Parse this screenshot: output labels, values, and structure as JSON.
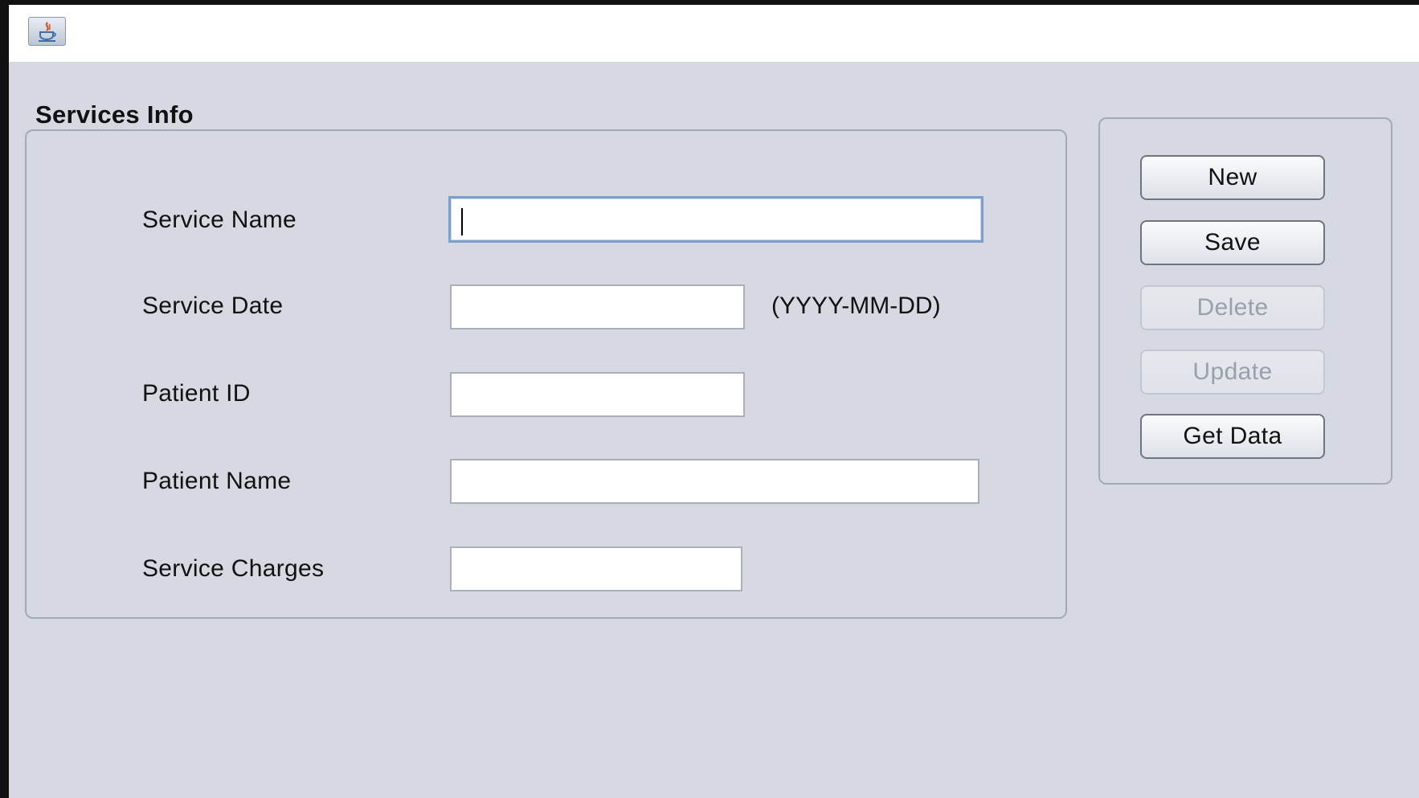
{
  "window": {
    "app_icon": "java-coffee-cup-icon"
  },
  "form": {
    "section_title": "Services Info",
    "fields": [
      {
        "label": "Service Name",
        "value": ""
      },
      {
        "label": "Service Date",
        "value": "",
        "hint": "(YYYY-MM-DD)"
      },
      {
        "label": "Patient ID",
        "value": ""
      },
      {
        "label": "Patient Name",
        "value": ""
      },
      {
        "label": "Service Charges",
        "value": ""
      }
    ]
  },
  "buttons": {
    "new": "New",
    "save": "Save",
    "delete": "Delete",
    "update": "Update",
    "get_data": "Get Data"
  },
  "button_states": {
    "delete_enabled": false,
    "update_enabled": false
  }
}
